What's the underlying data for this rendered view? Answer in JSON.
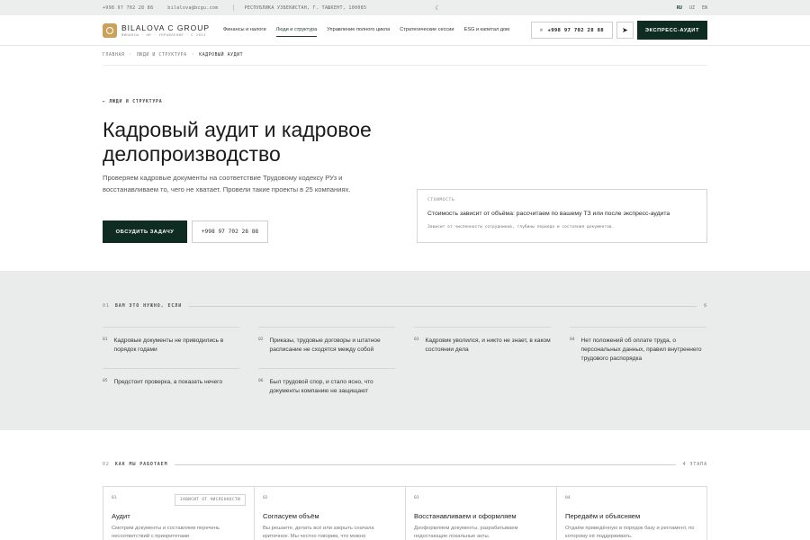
{
  "topbar": {
    "phone": "+998 97 702 28 88",
    "email": "bilalova@bcgu.com",
    "address": "РЕСПУБЛИКА УЗБЕКИСТАН, Г. ТАШКЕНТ, 100085",
    "langs": [
      "RU",
      "UZ",
      "EN"
    ]
  },
  "header": {
    "logo_name": "BILALOVA C GROUP",
    "logo_sub": "ФИНАНСЫ · HR · УПРАВЛЕНИЕ · С 2012",
    "nav": [
      {
        "label": "Финансы и налоги"
      },
      {
        "label": "Люди и структура"
      },
      {
        "label": "Управление полного цикла"
      },
      {
        "label": "Стратегические сессии"
      },
      {
        "label": "ESG и капитал дом"
      }
    ],
    "phone_button": "+998 97 702 28 88",
    "cta": "ЭКСПРЕСС-АУДИТ"
  },
  "breadcrumb": [
    "ГЛАВНАЯ",
    "ЛЮДИ И СТРУКТУРА",
    "КАДРОВЫЙ АУДИТ"
  ],
  "hero": {
    "back": "← ЛЮДИ И СТРУКТУРА",
    "title": "Кадровый аудит и кадровое делопроизводство",
    "description": "Проверяем кадровые документы на соответствие Трудовому кодексу РУз и восстанавливаем то, чего не хватает. Провели такие проекты в 25 компаниях.",
    "primary_btn": "ОБСУДИТЬ ЗАДАЧУ",
    "secondary_btn": "+998 97 702 28 88",
    "price": {
      "label": "СТОИМОСТЬ",
      "main": "Стоимость зависит от объёма: рассчитаем по вашему ТЗ или после экспресс-аудита",
      "note": "Зависит от численности сотрудников, глубины периода и состояния документов."
    }
  },
  "needs": {
    "num": "01",
    "title": "ВАМ ЭТО НУЖНО, ЕСЛИ",
    "count": "6",
    "items": [
      {
        "n": "01",
        "t": "Кадровые документы не приводились в порядок годами"
      },
      {
        "n": "02",
        "t": "Приказы, трудовые договоры и штатное расписание не сходятся между собой"
      },
      {
        "n": "03",
        "t": "Кадровик уволился, и никто не знает, в каком состоянии дела"
      },
      {
        "n": "04",
        "t": "Нет положений об оплате труда, о персональных данных, правил внутреннего трудового распорядка"
      },
      {
        "n": "05",
        "t": "Предстоит проверка, а показать нечего"
      },
      {
        "n": "06",
        "t": "Был трудовой спор, и стало ясно, что документы компанию не защищают"
      }
    ]
  },
  "how": {
    "num": "02",
    "title": "КАК МЫ РАБОТАЕМ",
    "count": "4 ЭТАПА",
    "steps": [
      {
        "n": "01",
        "title": "Аудит",
        "desc": "Смотрим документы и составляем перечень несоответствий с приоритетами",
        "tag": "ЗАВИСИТ ОТ ЧИСЛЕННОСТИ"
      },
      {
        "n": "02",
        "title": "Согласуем объём",
        "desc": "Вы решаете, делать всё или закрыть сначала критичное. Мы честно говорим, что можно"
      },
      {
        "n": "03",
        "title": "Восстанавливаем и оформляем",
        "desc": "Дооформляем документы, разрабатываем недостающие локальные акты."
      },
      {
        "n": "04",
        "title": "Передаём и объясняем",
        "desc": "Отдаём приведённую в порядок базу и регламент, по которому её поддерживать."
      }
    ]
  }
}
